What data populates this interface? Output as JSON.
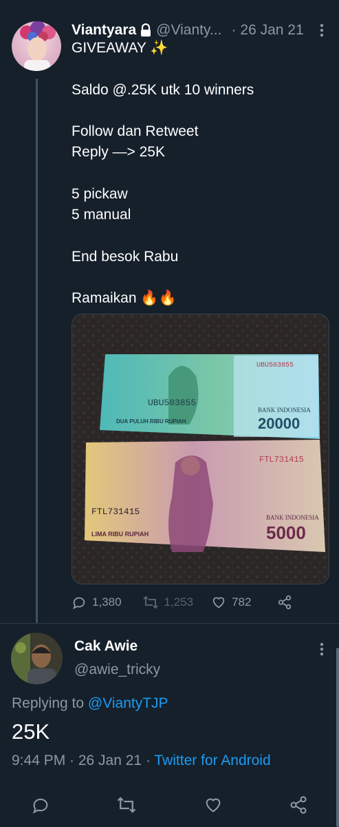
{
  "tweet": {
    "name": "Viantyara",
    "handle": "@Vianty...",
    "date": "26 Jan 21",
    "lines": [
      "GIVEAWAY ✨",
      "Saldo @.25K utk 10 winners",
      "Follow dan Retweet",
      "Reply —> 25K",
      "5 pickaw",
      "5 manual",
      "End besok Rabu",
      "Ramaikan 🔥🔥"
    ],
    "media": {
      "note1": {
        "serial": "UBU503855",
        "bank": "BANK INDONESIA",
        "value": "20000",
        "words": "DUA PULUH RIBU RUPIAH",
        "color": "#3fb0b3"
      },
      "note2": {
        "serial": "FTL731415",
        "bank": "BANK INDONESIA",
        "value": "5000",
        "words": "LIMA RIBU RUPIAH",
        "color": "#c89aa8"
      }
    },
    "stats": {
      "replies": "1,380",
      "retweets": "1,253",
      "likes": "782"
    }
  },
  "reply": {
    "name": "Cak Awie",
    "handle": "@awie_tricky",
    "replying_prefix": "Replying to ",
    "replying_to": "@ViantyTJP",
    "text": "25K",
    "time_date": "9:44 PM · 26 Jan 21 · ",
    "source": "Twitter for Android"
  },
  "colors": {
    "background": "#15202b",
    "secondary": "#8b98a5",
    "accent": "#1d9bf0"
  }
}
